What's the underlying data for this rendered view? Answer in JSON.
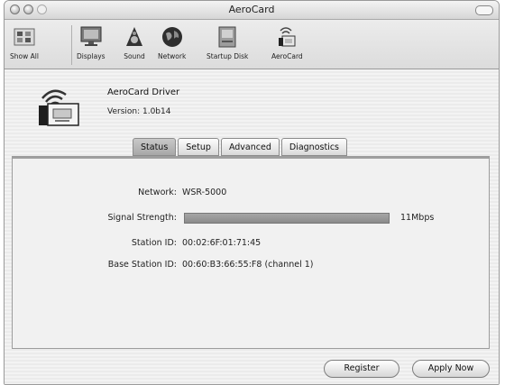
{
  "window": {
    "title": "AeroCard"
  },
  "toolbar": {
    "items": [
      {
        "label": "Show All",
        "icon": "grid-icon"
      },
      {
        "label": "Displays",
        "icon": "display-icon"
      },
      {
        "label": "Sound",
        "icon": "speaker-icon"
      },
      {
        "label": "Network",
        "icon": "globe-icon"
      },
      {
        "label": "Startup Disk",
        "icon": "disk-icon"
      },
      {
        "label": "AeroCard",
        "icon": "wireless-card-icon"
      }
    ]
  },
  "driver": {
    "name": "AeroCard Driver",
    "version": "Version: 1.0b14"
  },
  "tabs": [
    {
      "label": "Status",
      "active": true
    },
    {
      "label": "Setup",
      "active": false
    },
    {
      "label": "Advanced",
      "active": false
    },
    {
      "label": "Diagnostics",
      "active": false
    }
  ],
  "status": {
    "network_label": "Network:",
    "network_value": "WSR-5000",
    "signal_label": "Signal Strength:",
    "signal_level": 1.0,
    "signal_speed": "11Mbps",
    "station_label": "Station ID:",
    "station_value": "00:02:6F:01:71:45",
    "base_label": "Base Station ID:",
    "base_value": "00:60:B3:66:55:F8  (channel 1)"
  },
  "buttons": {
    "register": "Register",
    "apply": "Apply Now"
  }
}
